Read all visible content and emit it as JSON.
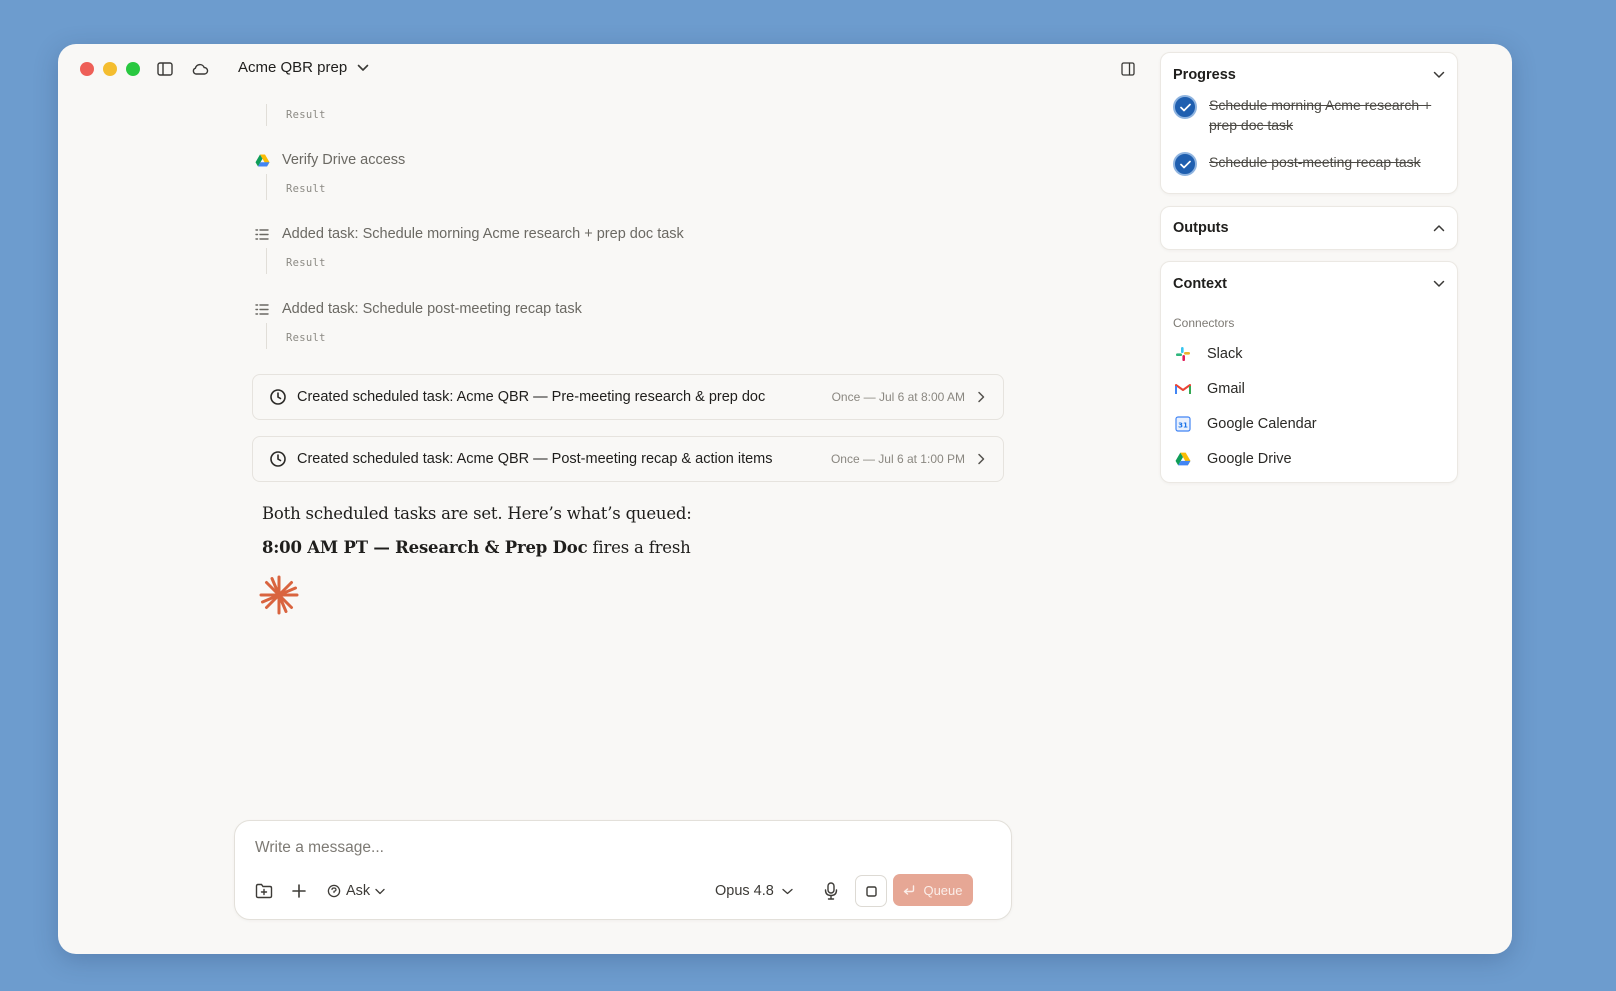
{
  "window": {
    "title": "Acme QBR prep"
  },
  "timeline": {
    "steps": [
      {
        "label": "",
        "result": "Result"
      },
      {
        "label": "Verify Drive access",
        "result": "Result"
      },
      {
        "label": "Added task: Schedule morning Acme research + prep doc task",
        "result": "Result"
      },
      {
        "label": "Added task: Schedule post-meeting recap task",
        "result": "Result"
      }
    ]
  },
  "task_cards": [
    {
      "label": "Created scheduled task: Acme QBR — Pre-meeting research & prep doc",
      "meta": "Once — Jul 6 at 8:00 AM"
    },
    {
      "label": "Created scheduled task: Acme QBR — Post-meeting recap & action items",
      "meta": "Once — Jul 6 at 1:00 PM"
    }
  ],
  "message": {
    "line1": "Both scheduled tasks are set. Here’s what’s queued:",
    "line2_bold": "8:00 AM PT — Research & Prep Doc",
    "line2_rest": " fires a fresh"
  },
  "composer": {
    "placeholder": "Write a message...",
    "mode": "Ask",
    "model": "Opus 4.8",
    "queue_label": "Queue"
  },
  "progress": {
    "title": "Progress",
    "items": [
      {
        "label": "Schedule morning Acme research + prep doc task",
        "done": true
      },
      {
        "label": "Schedule post-meeting recap task",
        "done": true
      }
    ]
  },
  "outputs": {
    "title": "Outputs"
  },
  "context": {
    "title": "Context",
    "connectors_label": "Connectors",
    "connectors": [
      {
        "name": "Slack",
        "icon": "slack-icon"
      },
      {
        "name": "Gmail",
        "icon": "gmail-icon"
      },
      {
        "name": "Google Calendar",
        "icon": "google-calendar-icon"
      },
      {
        "name": "Google Drive",
        "icon": "google-drive-icon"
      }
    ]
  },
  "colors": {
    "background": "#6d9cce",
    "accent": "#e6a795",
    "check": "#1f5fb0",
    "spark": "#d9643f"
  }
}
